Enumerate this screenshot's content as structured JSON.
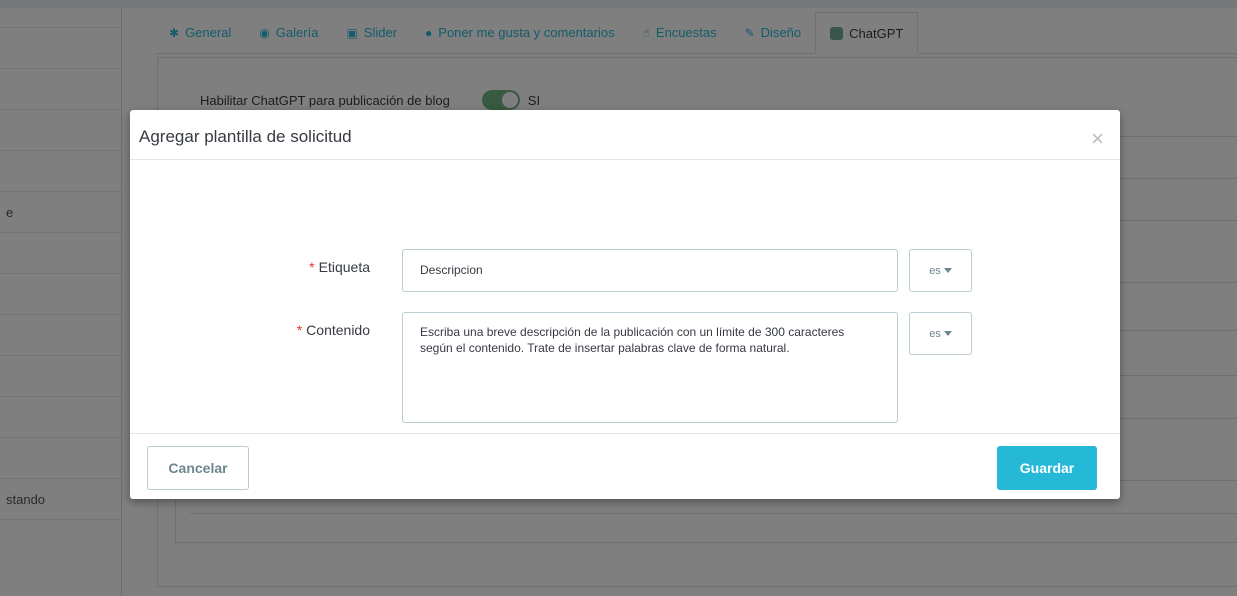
{
  "background": {
    "sidebar": {
      "items": [
        "",
        "",
        "",
        "",
        "",
        "e",
        "",
        "",
        "",
        "",
        "",
        "",
        "stando"
      ]
    },
    "tabs": [
      {
        "label": "General",
        "icon": "gear-icon",
        "glyph": "✱"
      },
      {
        "label": "Galería",
        "icon": "camera-icon",
        "glyph": "◉"
      },
      {
        "label": "Slider",
        "icon": "image-icon",
        "glyph": "▣"
      },
      {
        "label": "Poner me gusta y comentarios",
        "icon": "comments-icon",
        "glyph": "●"
      },
      {
        "label": "Encuestas",
        "icon": "thumbs-up-icon",
        "glyph": "☝"
      },
      {
        "label": "Diseño",
        "icon": "brush-icon",
        "glyph": "✎"
      },
      {
        "label": "ChatGPT",
        "icon": "chatgpt-icon",
        "glyph": "",
        "active": true
      }
    ],
    "setting": {
      "label": "Habilitar ChatGPT para publicación de blog",
      "toggle_value": "SI",
      "toggle_on": true
    }
  },
  "modal": {
    "title": "Agregar plantilla de solicitud",
    "close_glyph": "×",
    "fields": {
      "label_field": {
        "label": "Etiqueta",
        "required_mark": "*",
        "value": "Descripcion",
        "lang": "es"
      },
      "content_field": {
        "label": "Contenido",
        "required_mark": "*",
        "value": "Escriba una breve descripción de la publicación con un límite de 300 caracteres según el contenido. Trate de insertar palabras clave de forma natural.",
        "lang": "es"
      }
    },
    "footer": {
      "cancel_label": "Cancelar",
      "save_label": "Guardar"
    }
  },
  "colors": {
    "accent": "#25b9d7",
    "toggle_on": "#70b580",
    "required": "#e3342f"
  }
}
